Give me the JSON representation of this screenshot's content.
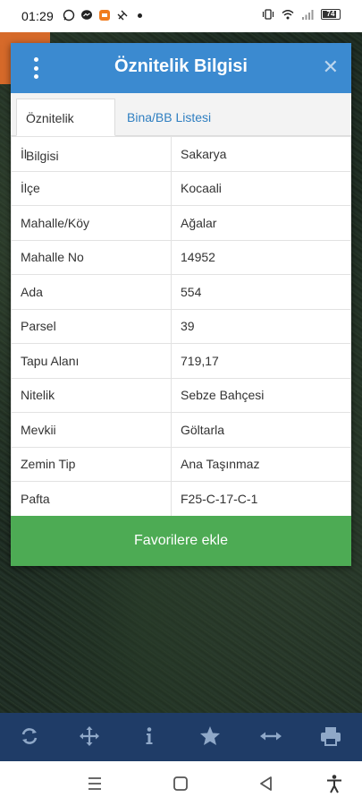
{
  "status": {
    "time": "01:29",
    "battery": "74"
  },
  "dialog": {
    "title": "Öznitelik Bilgisi",
    "close_label": "✕",
    "tabs": [
      {
        "label": "Öznitelik Bilgisi",
        "active": true
      },
      {
        "label": "Bina/BB Listesi",
        "active": false
      }
    ],
    "rows": [
      {
        "key": "İl",
        "value": "Sakarya"
      },
      {
        "key": "İlçe",
        "value": "Kocaali"
      },
      {
        "key": "Mahalle/Köy",
        "value": "Ağalar"
      },
      {
        "key": "Mahalle No",
        "value": "14952"
      },
      {
        "key": "Ada",
        "value": "554"
      },
      {
        "key": "Parsel",
        "value": "39"
      },
      {
        "key": "Tapu Alanı",
        "value": "719,17"
      },
      {
        "key": "Nitelik",
        "value": "Sebze Bahçesi"
      },
      {
        "key": "Mevkii",
        "value": "Göltarla"
      },
      {
        "key": "Zemin Tip",
        "value": "Ana Taşınmaz"
      },
      {
        "key": "Pafta",
        "value": "F25-C-17-C-1"
      }
    ],
    "favorite_button": "Favorilere ekle"
  },
  "toolbar": {
    "icons": [
      "refresh-icon",
      "move-icon",
      "info-icon",
      "star-icon",
      "measure-icon",
      "print-icon"
    ]
  },
  "colors": {
    "header": "#3b8ad0",
    "tab_link": "#2f7fc1",
    "favorite_button": "#4dab54",
    "toolbar": "#1f3c67",
    "toolbar_icon": "#8fa8c8"
  }
}
